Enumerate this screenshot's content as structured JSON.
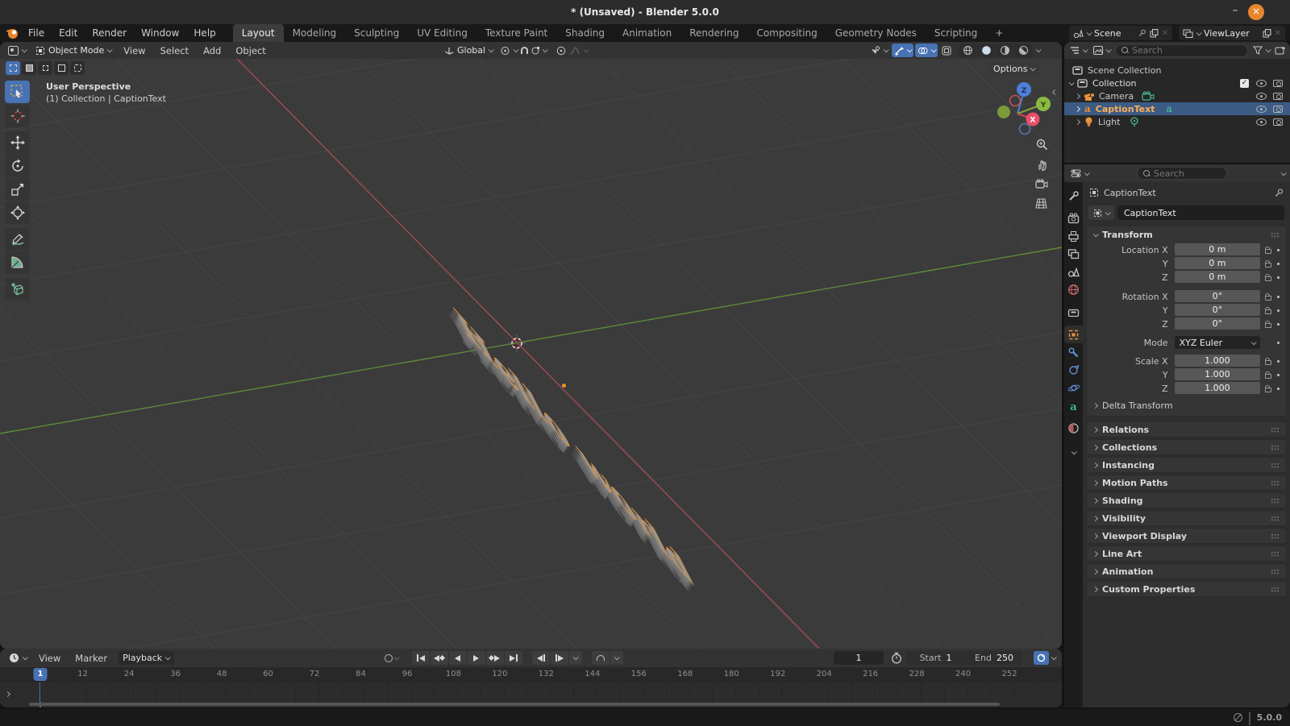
{
  "window": {
    "title": "* (Unsaved) - Blender 5.0.0",
    "minimize": "–",
    "close": "×"
  },
  "topbar": {
    "menus": [
      "File",
      "Edit",
      "Render",
      "Window",
      "Help"
    ],
    "tabs": [
      "Layout",
      "Modeling",
      "Sculpting",
      "UV Editing",
      "Texture Paint",
      "Shading",
      "Animation",
      "Rendering",
      "Compositing",
      "Geometry Nodes",
      "Scripting"
    ],
    "active_tab": "Layout",
    "add_tab_label": "+",
    "scene": {
      "label": "Scene"
    },
    "view_layer": {
      "label": "ViewLayer"
    }
  },
  "viewport_header": {
    "mode": "Object Mode",
    "menus": [
      "View",
      "Select",
      "Add",
      "Object"
    ],
    "orientation": "Global"
  },
  "viewport": {
    "perspective_label": "User Perspective",
    "context_label": "(1) Collection | CaptionText",
    "options_label": "Options",
    "text_object": "Hello world",
    "axis_labels": {
      "x": "X",
      "y": "Y",
      "z": "Z"
    }
  },
  "outliner": {
    "search_placeholder": "Search",
    "items": [
      {
        "label": "Scene Collection"
      },
      {
        "label": "Collection"
      },
      {
        "label": "Camera"
      },
      {
        "label": "CaptionText"
      },
      {
        "label": "Light"
      }
    ]
  },
  "properties": {
    "search_placeholder": "Search",
    "breadcrumb": "CaptionText",
    "object_name": "CaptionText",
    "transform": {
      "title": "Transform",
      "rows": [
        {
          "label": "Location X",
          "value": "0 m"
        },
        {
          "label": "Y",
          "value": "0 m"
        },
        {
          "label": "Z",
          "value": "0 m"
        },
        {
          "label": "Rotation X",
          "value": "0°"
        },
        {
          "label": "Y",
          "value": "0°"
        },
        {
          "label": "Z",
          "value": "0°"
        },
        {
          "label": "Scale X",
          "value": "1.000"
        },
        {
          "label": "Y",
          "value": "1.000"
        },
        {
          "label": "Z",
          "value": "1.000"
        }
      ],
      "mode_label": "Mode",
      "mode_value": "XYZ Euler",
      "delta_label": "Delta Transform"
    },
    "panels": [
      "Relations",
      "Collections",
      "Instancing",
      "Motion Paths",
      "Shading",
      "Visibility",
      "Viewport Display",
      "Line Art",
      "Animation",
      "Custom Properties"
    ]
  },
  "timeline": {
    "menus": [
      "View",
      "Marker"
    ],
    "playback_label": "Playback",
    "current_frame": "1",
    "start_label": "Start",
    "start_value": "1",
    "end_label": "End",
    "end_value": "250",
    "ruler": [
      1,
      12,
      24,
      36,
      48,
      60,
      72,
      84,
      96,
      108,
      120,
      132,
      144,
      156,
      168,
      180,
      192,
      204,
      216,
      228,
      240,
      252
    ]
  },
  "statusbar": {
    "version": "5.0.0"
  },
  "colors": {
    "accent_blue": "#4772b3",
    "accent_orange": "#e8923c",
    "selected_row": "#3b5b84",
    "axis_x": "#a14d52",
    "axis_y": "#5c8a39"
  }
}
